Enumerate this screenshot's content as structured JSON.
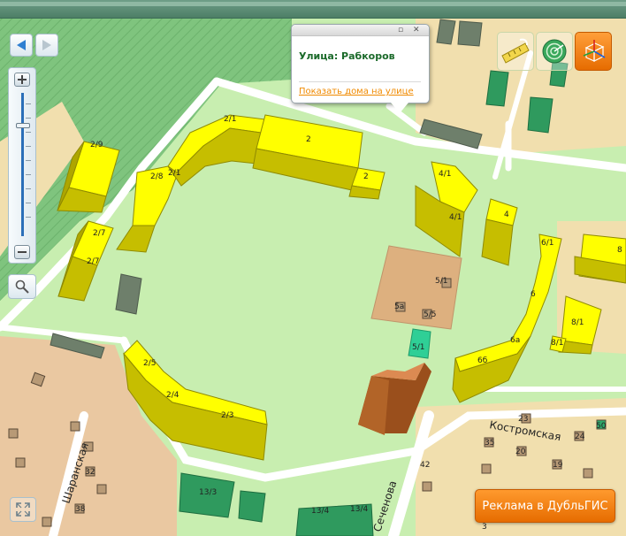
{
  "popup": {
    "title": "Улица: Рабкоров",
    "link": "Показать дома на улице"
  },
  "buildings": {
    "b2_9": "2/9",
    "b2_8": "2/8",
    "b2_1_small": "2/1",
    "b2_1": "2/1",
    "b2_main": "2",
    "b2_small": "2",
    "b2_7a": "2/7",
    "b2_7b": "2/7",
    "b2_5": "2/5",
    "b2_4": "2/4",
    "b2_3": "2/3",
    "b4_1a": "4/1",
    "b4_1b": "4/1",
    "b4": "4",
    "b6_1a": "6/1",
    "b6": "6",
    "b6a": "6а",
    "b6b": "6б",
    "b8_1a": "8/1",
    "b8_1b": "8/1",
    "b8": "8",
    "b5_1": "5/1",
    "b5a": "5а",
    "b5_5": "5/5",
    "b5_1_teal": "5/1",
    "b13_3": "13/3",
    "b13_4a": "13/4",
    "b13_4b": "13/4",
    "b23": "23",
    "b35": "35",
    "b20": "20",
    "b24": "24",
    "b50": "50",
    "b42": "42",
    "b19": "19",
    "b32": "32",
    "b38": "38",
    "b3": "3"
  },
  "streets": {
    "kostromskaya": "Костромская",
    "sharanskaya": "Шаранская",
    "sechenova": "Сеченова"
  },
  "tools": [
    "ruler-icon",
    "radar-icon",
    "3d-cube-icon"
  ],
  "ad": {
    "label": "Реклама в ДубльГИС"
  },
  "colors": {
    "grass": "#c8eeb0",
    "residential": "#f1dfae",
    "brown_lot": "#ddb07f",
    "building_roof": "#ffff00",
    "building_wall": "#c6be00",
    "accent_orange": "#f08a00"
  }
}
